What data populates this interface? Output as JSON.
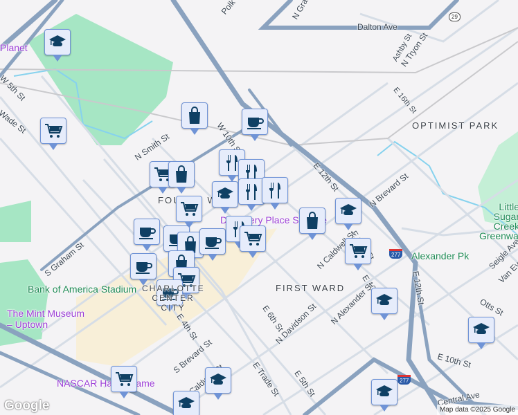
{
  "map": {
    "neighborhoods": [
      "OPTIMIST PARK",
      "FIRST WARD",
      "FOURTH WARD",
      "CHARLOTTE CENTER CITY"
    ],
    "streets": [
      "Dalton Ave",
      "N Graham St",
      "Polk St",
      "N Tryon St",
      "Ashby St",
      "E 16th St",
      "W 5th St",
      "N Smith St",
      "W 10th St",
      "E 12th St",
      "N Brevard St",
      "E 11th St",
      "N Caldwell St",
      "E 10th St",
      "N Alexander St",
      "N Davidson St",
      "E 6th St",
      "S Graham St",
      "E 4th St",
      "S Brevard St",
      "E Trade St",
      "E 5th St",
      "S Caldwell St",
      "Otts St",
      "Seigle Ave",
      "Van Every St",
      "Central Ave",
      "Wade St"
    ],
    "places": {
      "discovery_place": "Discovery Place Science",
      "bank_of_america": "Bank of America Stadium",
      "mint_museum": "The Mint Museum – Uptown",
      "nascar": "NASCAR Hall of Fame",
      "alexander_pk": "Alexander Pk",
      "little_sugar": "Little Sugar Creek Greenway",
      "planet": "Planet"
    },
    "shields": [
      "29",
      "277",
      "277"
    ],
    "attribution": "Map data ©2025 Google",
    "logo": "Google",
    "markers": [
      {
        "type": "school"
      },
      {
        "type": "grocery"
      },
      {
        "type": "shopping"
      },
      {
        "type": "cafe"
      },
      {
        "type": "restaurant"
      },
      {
        "type": "restaurant"
      },
      {
        "type": "school"
      },
      {
        "type": "restaurant"
      },
      {
        "type": "restaurant"
      },
      {
        "type": "grocery"
      },
      {
        "type": "shopping"
      },
      {
        "type": "grocery"
      },
      {
        "type": "cafe"
      },
      {
        "type": "cafe"
      },
      {
        "type": "shopping"
      },
      {
        "type": "cafe"
      },
      {
        "type": "restaurant"
      },
      {
        "type": "grocery"
      },
      {
        "type": "cafe"
      },
      {
        "type": "shopping"
      },
      {
        "type": "grocery"
      },
      {
        "type": "cafe"
      },
      {
        "type": "shopping"
      },
      {
        "type": "school"
      },
      {
        "type": "grocery"
      },
      {
        "type": "school"
      },
      {
        "type": "school"
      },
      {
        "type": "school"
      },
      {
        "type": "grocery"
      },
      {
        "type": "school"
      },
      {
        "type": "school"
      }
    ]
  }
}
